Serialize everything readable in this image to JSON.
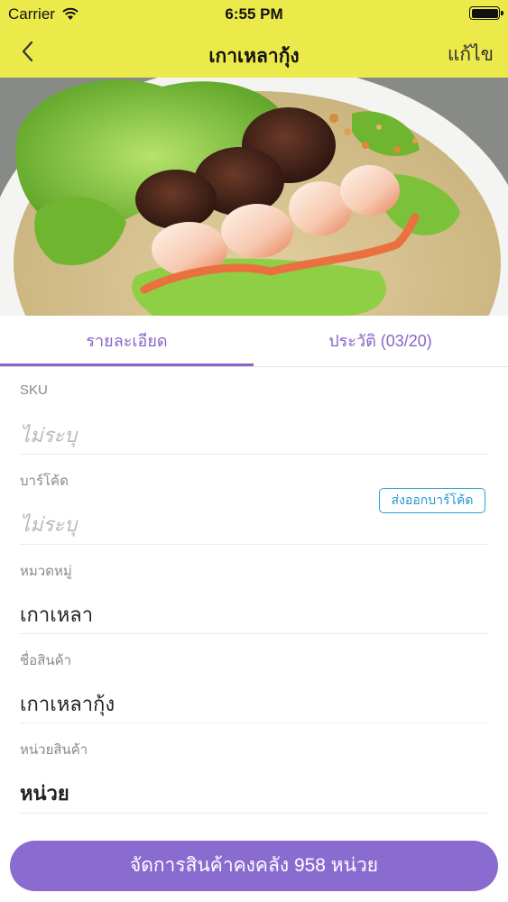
{
  "status_bar": {
    "carrier": "Carrier",
    "time": "6:55 PM",
    "wifi_icon": "wifi-icon",
    "battery_icon": "battery-icon"
  },
  "nav": {
    "back_icon": "chevron-left-icon",
    "title": "เกาเหลากุ้ง",
    "edit_label": "แก้ไข"
  },
  "hero": {
    "description_icon": "food-photo"
  },
  "tabs": [
    {
      "label": "รายละเอียด",
      "active": true
    },
    {
      "label": "ประวัติ (03/20)",
      "active": false
    }
  ],
  "fields": {
    "sku": {
      "label": "SKU",
      "value": "ไม่ระบุ"
    },
    "barcode": {
      "label": "บาร์โค้ด",
      "value": "ไม่ระบุ",
      "action_label": "ส่งออกบาร์โค้ด"
    },
    "category": {
      "label": "หมวดหมู่",
      "value": "เกาเหลา"
    },
    "product_name": {
      "label": "ชื่อสินค้า",
      "value": "เกาเหลากุ้ง"
    },
    "unit": {
      "label": "หน่วยสินค้า",
      "value": "หน่วย"
    }
  },
  "bottom_button": {
    "label": "จัดการสินค้าคงคลัง 958 หน่วย"
  },
  "colors": {
    "nav_bar": "#ecea4a",
    "accent": "#8a63c8",
    "button": "#8a6bcf",
    "link": "#2596cc"
  }
}
